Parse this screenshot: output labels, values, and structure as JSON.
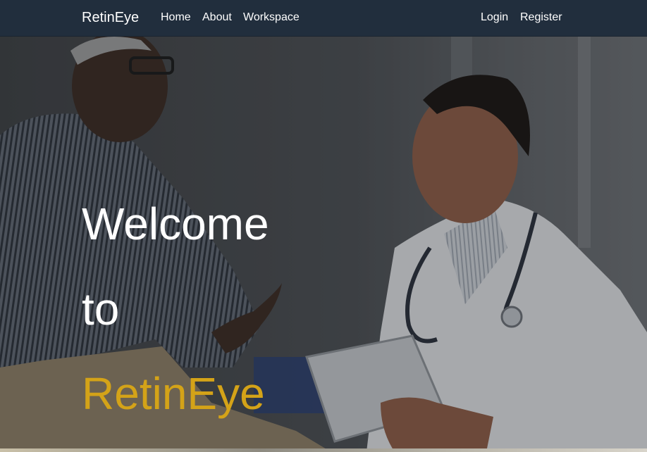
{
  "navbar": {
    "brand": "RetinEye",
    "left_links": [
      {
        "label": "Home"
      },
      {
        "label": "About"
      },
      {
        "label": "Workspace"
      }
    ],
    "right_links": [
      {
        "label": "Login"
      },
      {
        "label": "Register"
      }
    ]
  },
  "hero": {
    "line1": "Welcome",
    "line2": "to",
    "line3": "RetinEye",
    "accent_color": "#d4a318",
    "image": "hero-photo-doctor-patient"
  }
}
